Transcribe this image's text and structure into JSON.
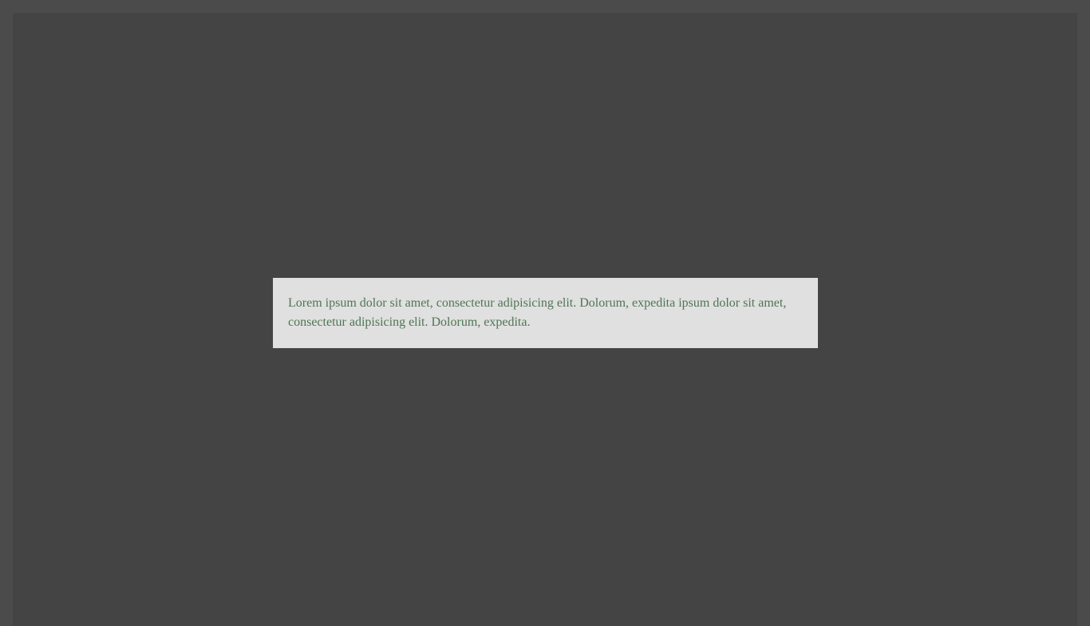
{
  "notice": {
    "text": "Lorem ipsum dolor sit amet, consectetur adipisicing elit. Dolorum, expedita ipsum dolor sit amet, consectetur adipisicing elit. Dolorum, expedita."
  },
  "colors": {
    "page_frame": "#4b4b4b",
    "viewport_background": "#444444",
    "notice_background": "#e0e0e0",
    "notice_text": "#4f7553"
  }
}
